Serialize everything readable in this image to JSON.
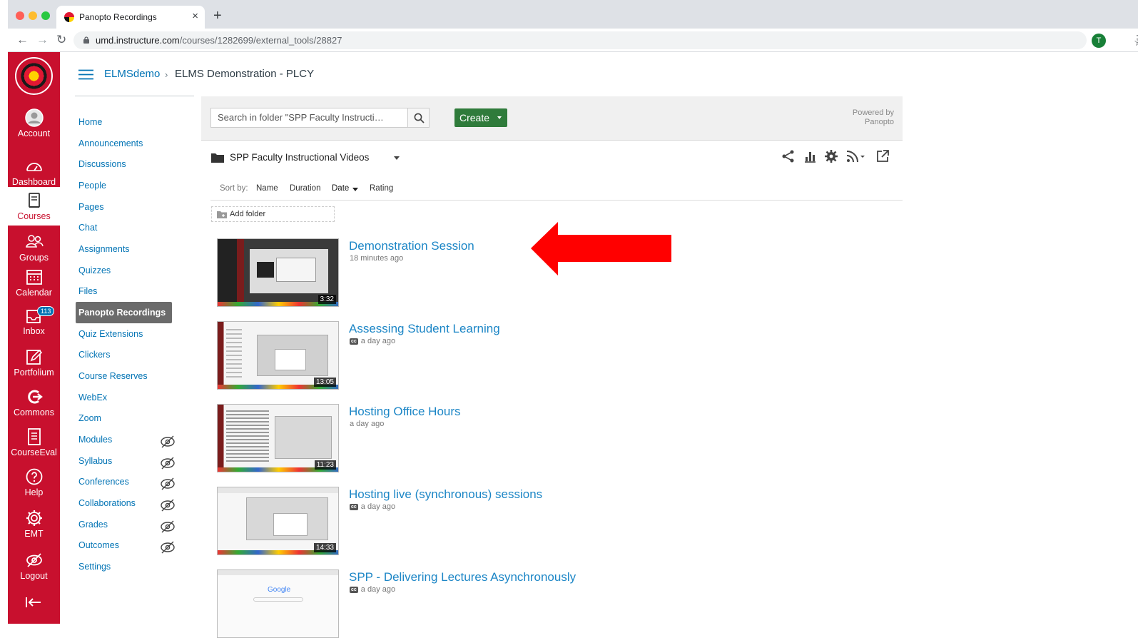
{
  "browser": {
    "tab_title": "Panopto Recordings",
    "tab_close": "×",
    "new_tab": "+",
    "url_host": "umd.instructure.com",
    "url_path": "/courses/1282699/external_tools/28827",
    "profile_initial": "T",
    "back": "←",
    "forward": "→",
    "reload": "↻",
    "star": "☆",
    "menu": "⋮"
  },
  "global_nav": {
    "items": [
      {
        "label": "Account",
        "icon": "account-icon"
      },
      {
        "label": "Dashboard",
        "icon": "dashboard-icon"
      },
      {
        "label": "Courses",
        "icon": "courses-icon",
        "active": true
      },
      {
        "label": "Groups",
        "icon": "groups-icon"
      },
      {
        "label": "Calendar",
        "icon": "calendar-icon"
      },
      {
        "label": "Inbox",
        "icon": "inbox-icon",
        "badge": "113"
      },
      {
        "label": "Portfolium",
        "icon": "portfolium-icon"
      },
      {
        "label": "Commons",
        "icon": "commons-icon"
      },
      {
        "label": "CourseEval",
        "icon": "courseeval-icon"
      },
      {
        "label": "Help",
        "icon": "help-icon"
      },
      {
        "label": "EMT",
        "icon": "gear-icon"
      },
      {
        "label": "Logout",
        "icon": "logout-icon"
      }
    ],
    "collapse_icon": "collapse-icon"
  },
  "header": {
    "breadcrumb_course": "ELMSdemo",
    "breadcrumb_sep": "›",
    "breadcrumb_current": "ELMS Demonstration - PLCY"
  },
  "course_nav": {
    "items": [
      {
        "label": "Home"
      },
      {
        "label": "Announcements"
      },
      {
        "label": "Discussions"
      },
      {
        "label": "People"
      },
      {
        "label": "Pages"
      },
      {
        "label": "Chat"
      },
      {
        "label": "Assignments"
      },
      {
        "label": "Quizzes"
      },
      {
        "label": "Files"
      },
      {
        "label": "Panopto Recordings",
        "active": true
      },
      {
        "label": "Quiz Extensions"
      },
      {
        "label": "Clickers"
      },
      {
        "label": "Course Reserves"
      },
      {
        "label": "WebEx"
      },
      {
        "label": "Zoom"
      },
      {
        "label": "Modules",
        "hidden": true
      },
      {
        "label": "Syllabus",
        "hidden": true
      },
      {
        "label": "Conferences",
        "hidden": true
      },
      {
        "label": "Collaborations",
        "hidden": true
      },
      {
        "label": "Grades",
        "hidden": true
      },
      {
        "label": "Outcomes",
        "hidden": true
      },
      {
        "label": "Settings"
      }
    ]
  },
  "panopto": {
    "search_placeholder": "Search in folder \"SPP Faculty Instructi…",
    "create_label": "Create",
    "powered_by_line1": "Powered by",
    "powered_by_line2": "Panopto",
    "folder_name": "SPP Faculty Instructional Videos",
    "actions": [
      "share-icon",
      "stats-icon",
      "settings-icon",
      "rss-icon",
      "open-external-icon"
    ],
    "sort": {
      "label": "Sort by:",
      "options": [
        "Name",
        "Duration",
        "Date",
        "Rating"
      ],
      "active": "Date"
    },
    "add_folder": "Add folder",
    "cc_label": "cc",
    "sessions": [
      {
        "title": "Demonstration Session",
        "meta": "18 minutes ago",
        "duration": "3:32",
        "cc": false
      },
      {
        "title": "Assessing Student Learning",
        "meta": "a day ago",
        "duration": "13:05",
        "cc": true
      },
      {
        "title": "Hosting Office Hours",
        "meta": "a day ago",
        "duration": "11:23",
        "cc": false
      },
      {
        "title": "Hosting live (synchronous) sessions",
        "meta": "a day ago",
        "duration": "14:33",
        "cc": true
      },
      {
        "title": "SPP - Delivering Lectures Asynchronously",
        "meta": "a day ago",
        "duration": "",
        "cc": true,
        "thumb_text": "Google"
      }
    ]
  },
  "colors": {
    "global_nav_bg": "#c8102e",
    "link": "#0374b5",
    "create_green": "#2f7b3b",
    "annotation_arrow": "#ff0000"
  }
}
